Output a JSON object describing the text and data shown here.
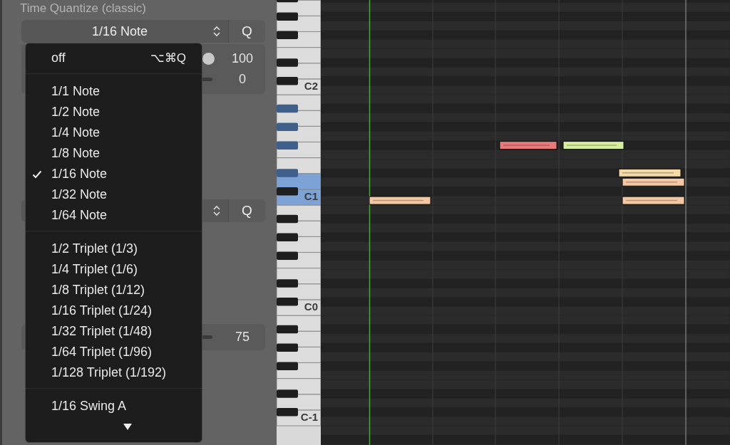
{
  "panel": {
    "title": "Time Quantize (classic)",
    "selector": {
      "value": "1/16 Note",
      "button": "Q"
    },
    "sliders": [
      {
        "reading": "100",
        "level": 1
      },
      {
        "reading": "0"
      }
    ],
    "selector_2": {
      "button": "Q"
    },
    "slider_3": {
      "reading": "75"
    }
  },
  "menu": {
    "groups": [
      [
        {
          "label": "off",
          "shortcut": "⌥⌘Q",
          "selected": false
        }
      ],
      [
        {
          "label": "1/1 Note",
          "selected": false
        },
        {
          "label": "1/2 Note",
          "selected": false
        },
        {
          "label": "1/4 Note",
          "selected": false
        },
        {
          "label": "1/8 Note",
          "selected": false
        },
        {
          "label": "1/16 Note",
          "selected": true
        },
        {
          "label": "1/32 Note",
          "selected": false
        },
        {
          "label": "1/64 Note",
          "selected": false
        }
      ],
      [
        {
          "label": "1/2 Triplet (1/3)",
          "selected": false
        },
        {
          "label": "1/4 Triplet (1/6)",
          "selected": false
        },
        {
          "label": "1/8 Triplet (1/12)",
          "selected": false
        },
        {
          "label": "1/16 Triplet (1/24)",
          "selected": false
        },
        {
          "label": "1/32 Triplet (1/48)",
          "selected": false
        },
        {
          "label": "1/64 Triplet (1/96)",
          "selected": false
        },
        {
          "label": "1/128 Triplet (1/192)",
          "selected": false
        }
      ],
      [
        {
          "label": "1/16 Swing A",
          "selected": false
        }
      ]
    ],
    "more_below": true
  },
  "piano_roll": {
    "key_labels": [
      "C2",
      "C1",
      "C0",
      "C-1"
    ],
    "notes": [
      {
        "color": "#e87a7a"
      },
      {
        "color": "#d6ef9f"
      },
      {
        "color": "#f3d9a6"
      },
      {
        "color": "#f4c8a4"
      },
      {
        "color": "#f4c8a4"
      },
      {
        "color": "#f4c8a4"
      }
    ]
  }
}
